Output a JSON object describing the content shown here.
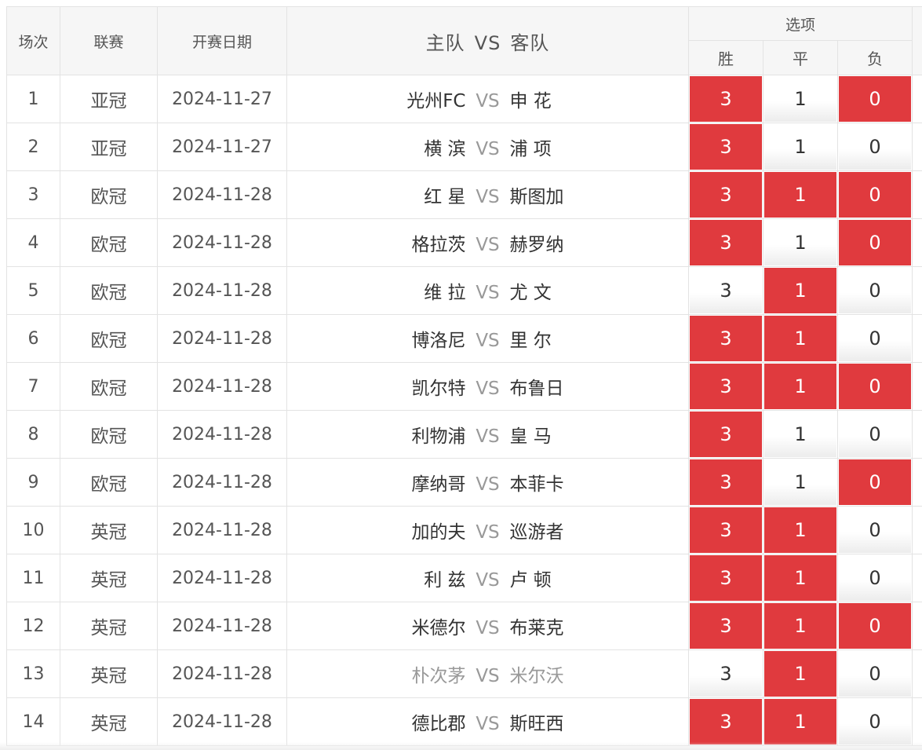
{
  "header": {
    "round": "场次",
    "league": "联赛",
    "date": "开赛日期",
    "home": "主队",
    "vs": "VS",
    "away": "客队",
    "options": "选项",
    "win": "胜",
    "draw": "平",
    "lose": "负"
  },
  "colors": {
    "selected": "#e03a3e",
    "border": "#e3e3e3",
    "header_bg": "#f6f6f6"
  },
  "rows": [
    {
      "num": "1",
      "league": "亚冠",
      "date": "2024-11-27",
      "home": "光州FC",
      "vs": "VS",
      "away": "申 花",
      "win": "3",
      "draw": "1",
      "lose": "0",
      "win_sel": true,
      "draw_sel": false,
      "lose_sel": true,
      "muted": false
    },
    {
      "num": "2",
      "league": "亚冠",
      "date": "2024-11-27",
      "home": "横 滨",
      "vs": "VS",
      "away": "浦 项",
      "win": "3",
      "draw": "1",
      "lose": "0",
      "win_sel": true,
      "draw_sel": false,
      "lose_sel": false,
      "muted": false
    },
    {
      "num": "3",
      "league": "欧冠",
      "date": "2024-11-28",
      "home": "红 星",
      "vs": "VS",
      "away": "斯图加",
      "win": "3",
      "draw": "1",
      "lose": "0",
      "win_sel": true,
      "draw_sel": true,
      "lose_sel": true,
      "muted": false
    },
    {
      "num": "4",
      "league": "欧冠",
      "date": "2024-11-28",
      "home": "格拉茨",
      "vs": "VS",
      "away": "赫罗纳",
      "win": "3",
      "draw": "1",
      "lose": "0",
      "win_sel": true,
      "draw_sel": false,
      "lose_sel": true,
      "muted": false
    },
    {
      "num": "5",
      "league": "欧冠",
      "date": "2024-11-28",
      "home": "维 拉",
      "vs": "VS",
      "away": "尤 文",
      "win": "3",
      "draw": "1",
      "lose": "0",
      "win_sel": false,
      "draw_sel": true,
      "lose_sel": false,
      "muted": false
    },
    {
      "num": "6",
      "league": "欧冠",
      "date": "2024-11-28",
      "home": "博洛尼",
      "vs": "VS",
      "away": "里 尔",
      "win": "3",
      "draw": "1",
      "lose": "0",
      "win_sel": true,
      "draw_sel": true,
      "lose_sel": false,
      "muted": false
    },
    {
      "num": "7",
      "league": "欧冠",
      "date": "2024-11-28",
      "home": "凯尔特",
      "vs": "VS",
      "away": "布鲁日",
      "win": "3",
      "draw": "1",
      "lose": "0",
      "win_sel": true,
      "draw_sel": true,
      "lose_sel": true,
      "muted": false
    },
    {
      "num": "8",
      "league": "欧冠",
      "date": "2024-11-28",
      "home": "利物浦",
      "vs": "VS",
      "away": "皇 马",
      "win": "3",
      "draw": "1",
      "lose": "0",
      "win_sel": true,
      "draw_sel": false,
      "lose_sel": false,
      "muted": false
    },
    {
      "num": "9",
      "league": "欧冠",
      "date": "2024-11-28",
      "home": "摩纳哥",
      "vs": "VS",
      "away": "本菲卡",
      "win": "3",
      "draw": "1",
      "lose": "0",
      "win_sel": true,
      "draw_sel": false,
      "lose_sel": true,
      "muted": false
    },
    {
      "num": "10",
      "league": "英冠",
      "date": "2024-11-28",
      "home": "加的夫",
      "vs": "VS",
      "away": "巡游者",
      "win": "3",
      "draw": "1",
      "lose": "0",
      "win_sel": true,
      "draw_sel": true,
      "lose_sel": false,
      "muted": false
    },
    {
      "num": "11",
      "league": "英冠",
      "date": "2024-11-28",
      "home": "利 兹",
      "vs": "VS",
      "away": "卢 顿",
      "win": "3",
      "draw": "1",
      "lose": "0",
      "win_sel": true,
      "draw_sel": true,
      "lose_sel": false,
      "muted": false
    },
    {
      "num": "12",
      "league": "英冠",
      "date": "2024-11-28",
      "home": "米德尔",
      "vs": "VS",
      "away": "布莱克",
      "win": "3",
      "draw": "1",
      "lose": "0",
      "win_sel": true,
      "draw_sel": true,
      "lose_sel": true,
      "muted": false
    },
    {
      "num": "13",
      "league": "英冠",
      "date": "2024-11-28",
      "home": "朴次茅",
      "vs": "VS",
      "away": "米尔沃",
      "win": "3",
      "draw": "1",
      "lose": "0",
      "win_sel": false,
      "draw_sel": true,
      "lose_sel": false,
      "muted": true
    },
    {
      "num": "14",
      "league": "英冠",
      "date": "2024-11-28",
      "home": "德比郡",
      "vs": "VS",
      "away": "斯旺西",
      "win": "3",
      "draw": "1",
      "lose": "0",
      "win_sel": true,
      "draw_sel": true,
      "lose_sel": false,
      "muted": false
    }
  ]
}
